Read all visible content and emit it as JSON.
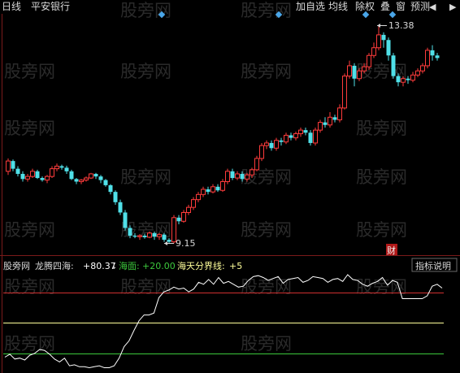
{
  "header": {
    "period": "日线",
    "stock_name": "平安银行",
    "buttons": [
      "加自选",
      "均线",
      "除权",
      "叠",
      "窗",
      "预测"
    ],
    "arrow_left": "◀",
    "arrow_right": "▶"
  },
  "price_panel": {
    "high_label": "13.38",
    "low_label": "9.15",
    "cai_badge": "财"
  },
  "indicator_panel": {
    "prefix": "股旁网",
    "name": "龙腾四海:",
    "value": "+80.37",
    "down_arrow": "↓",
    "sea_label": "海面:",
    "sea_value": "+20.00",
    "boundary_label": "海天分界线:",
    "boundary_value": "+5",
    "help_button": "指标说明"
  },
  "watermarks": [
    "股旁网"
  ],
  "colors": {
    "background": "#000000",
    "up": "#ff3b3b",
    "down": "#50e0e8",
    "text": "#d8d8d8",
    "red_line": "#d03030",
    "yellow_line": "#ffff9a",
    "green_line": "#3cc83c",
    "accent": "#4aa6e8"
  },
  "chart_data": {
    "type": "candlestick",
    "price_high": 13.38,
    "price_low": 9.15,
    "indicator": {
      "name": "龙腾四海",
      "current": 80.37,
      "sea_level": 20.0,
      "boundary_prefix": 5,
      "ylim": [
        0,
        100
      ],
      "values": [
        14,
        17,
        12,
        13,
        11,
        16,
        18,
        22,
        21,
        17,
        12,
        9,
        13,
        5,
        6,
        4,
        4,
        3,
        4,
        5,
        3,
        3,
        5,
        13,
        25,
        31,
        42,
        52,
        58,
        58,
        60,
        76,
        82,
        84,
        87,
        85,
        86,
        82,
        85,
        92,
        90,
        95,
        90,
        97,
        91,
        93,
        90,
        87,
        88,
        94,
        98,
        99,
        97,
        94,
        96,
        98,
        91,
        95,
        96,
        97,
        92,
        94,
        98,
        97,
        96,
        92,
        95,
        96,
        93,
        100,
        95,
        94,
        90,
        88,
        91,
        93,
        97,
        89,
        94,
        92,
        75,
        75,
        75,
        75,
        75,
        78,
        88,
        90,
        86
      ]
    },
    "candles": [
      [
        10.55,
        10.75,
        10.48,
        10.8
      ],
      [
        10.75,
        10.6,
        10.55,
        10.78
      ],
      [
        10.6,
        10.5,
        10.45,
        10.65
      ],
      [
        10.5,
        10.4,
        10.35,
        10.55
      ],
      [
        10.4,
        10.45,
        10.35,
        10.5
      ],
      [
        10.45,
        10.55,
        10.42,
        10.6
      ],
      [
        10.55,
        10.42,
        10.4,
        10.58
      ],
      [
        10.42,
        10.38,
        10.35,
        10.45
      ],
      [
        10.38,
        10.45,
        10.32,
        10.48
      ],
      [
        10.45,
        10.6,
        10.42,
        10.65
      ],
      [
        10.6,
        10.65,
        10.55,
        10.7
      ],
      [
        10.65,
        10.62,
        10.58,
        10.68
      ],
      [
        10.62,
        10.55,
        10.5,
        10.66
      ],
      [
        10.55,
        10.4,
        10.38,
        10.58
      ],
      [
        10.4,
        10.35,
        10.3,
        10.42
      ],
      [
        10.35,
        10.38,
        10.3,
        10.4
      ],
      [
        10.38,
        10.42,
        10.35,
        10.45
      ],
      [
        10.42,
        10.5,
        10.4,
        10.52
      ],
      [
        10.5,
        10.45,
        10.4,
        10.52
      ],
      [
        10.45,
        10.38,
        10.32,
        10.48
      ],
      [
        10.38,
        10.28,
        10.25,
        10.4
      ],
      [
        10.28,
        10.15,
        10.1,
        10.3
      ],
      [
        10.15,
        9.95,
        9.9,
        10.18
      ],
      [
        9.95,
        9.75,
        9.7,
        10.0
      ],
      [
        9.75,
        9.45,
        9.4,
        9.8
      ],
      [
        9.45,
        9.3,
        9.25,
        9.5
      ],
      [
        9.3,
        9.28,
        9.25,
        9.35
      ],
      [
        9.28,
        9.3,
        9.22,
        9.33
      ],
      [
        9.3,
        9.27,
        9.24,
        9.34
      ],
      [
        9.27,
        9.35,
        9.25,
        9.38
      ],
      [
        9.35,
        9.28,
        9.22,
        9.38
      ],
      [
        9.28,
        9.32,
        9.22,
        9.35
      ],
      [
        9.32,
        9.22,
        9.18,
        9.35
      ],
      [
        9.22,
        9.18,
        9.15,
        9.25
      ],
      [
        9.18,
        9.65,
        9.15,
        9.7
      ],
      [
        9.65,
        9.58,
        9.52,
        9.7
      ],
      [
        9.58,
        9.75,
        9.55,
        9.8
      ],
      [
        9.75,
        9.85,
        9.7,
        9.9
      ],
      [
        9.85,
        10.0,
        9.8,
        10.05
      ],
      [
        10.0,
        10.1,
        9.95,
        10.15
      ],
      [
        10.1,
        10.2,
        10.05,
        10.25
      ],
      [
        10.2,
        10.15,
        10.1,
        10.25
      ],
      [
        10.15,
        10.25,
        10.12,
        10.3
      ],
      [
        10.25,
        10.18,
        10.15,
        10.3
      ],
      [
        10.18,
        10.35,
        10.15,
        10.4
      ],
      [
        10.35,
        10.55,
        10.3,
        10.6
      ],
      [
        10.55,
        10.42,
        10.38,
        10.6
      ],
      [
        10.42,
        10.5,
        10.38,
        10.55
      ],
      [
        10.5,
        10.4,
        10.35,
        10.55
      ],
      [
        10.4,
        10.48,
        10.35,
        10.52
      ],
      [
        10.48,
        10.58,
        10.42,
        10.62
      ],
      [
        10.58,
        10.8,
        10.55,
        10.85
      ],
      [
        10.8,
        11.05,
        10.75,
        11.1
      ],
      [
        11.05,
        11.1,
        10.98,
        11.15
      ],
      [
        11.1,
        11.0,
        10.95,
        11.15
      ],
      [
        11.0,
        11.15,
        10.95,
        11.2
      ],
      [
        11.15,
        11.12,
        11.05,
        11.2
      ],
      [
        11.12,
        11.25,
        11.08,
        11.3
      ],
      [
        11.25,
        11.2,
        11.15,
        11.3
      ],
      [
        11.2,
        11.28,
        11.15,
        11.32
      ],
      [
        11.28,
        11.35,
        11.22,
        11.4
      ],
      [
        11.35,
        11.3,
        11.25,
        11.4
      ],
      [
        11.3,
        11.1,
        11.05,
        11.35
      ],
      [
        11.1,
        11.35,
        11.05,
        11.4
      ],
      [
        11.35,
        11.5,
        11.3,
        11.55
      ],
      [
        11.5,
        11.45,
        11.4,
        11.6
      ],
      [
        11.45,
        11.6,
        11.4,
        11.7
      ],
      [
        11.6,
        11.55,
        11.5,
        11.65
      ],
      [
        11.55,
        11.78,
        11.5,
        11.85
      ],
      [
        11.78,
        12.4,
        11.75,
        12.45
      ],
      [
        12.4,
        12.6,
        12.35,
        12.7
      ],
      [
        12.6,
        12.35,
        12.2,
        12.65
      ],
      [
        12.35,
        12.5,
        12.3,
        12.55
      ],
      [
        12.5,
        12.58,
        12.45,
        12.65
      ],
      [
        12.58,
        12.8,
        12.52,
        12.85
      ],
      [
        12.8,
        12.95,
        12.75,
        13.05
      ],
      [
        12.95,
        13.2,
        12.9,
        13.38
      ],
      [
        13.2,
        13.1,
        12.95,
        13.25
      ],
      [
        13.1,
        12.8,
        12.7,
        13.15
      ],
      [
        12.8,
        12.4,
        12.35,
        12.85
      ],
      [
        12.4,
        12.28,
        12.2,
        12.45
      ],
      [
        12.28,
        12.35,
        12.2,
        12.4
      ],
      [
        12.35,
        12.32,
        12.25,
        12.4
      ],
      [
        12.32,
        12.42,
        12.28,
        12.48
      ],
      [
        12.42,
        12.5,
        12.38,
        12.55
      ],
      [
        12.5,
        12.6,
        12.45,
        12.65
      ],
      [
        12.6,
        12.9,
        12.55,
        12.95
      ],
      [
        12.9,
        12.8,
        12.7,
        13.0
      ],
      [
        12.8,
        12.75,
        12.7,
        12.85
      ]
    ]
  }
}
